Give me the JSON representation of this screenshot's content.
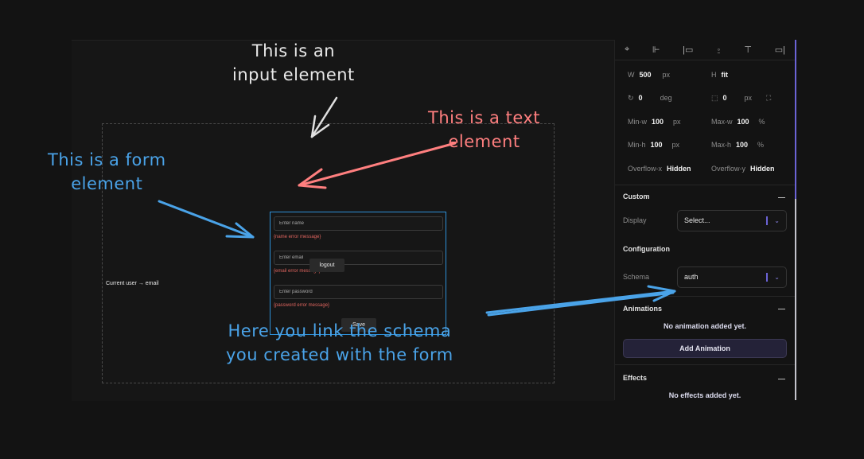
{
  "canvas": {
    "form": {
      "fields": [
        {
          "placeholder": "Enter name",
          "error": "{name error message}"
        },
        {
          "placeholder": "Enter email",
          "error": "{email error message}"
        },
        {
          "placeholder": "Enter password",
          "error": "{password error message}"
        }
      ],
      "save_label": "Save"
    },
    "logout_label": "logout",
    "current_user_text": "Current user → email"
  },
  "annotations": {
    "input_note": "This is an\ninput element",
    "text_note": "This is a text\nelement",
    "form_note": "This is a form\nelement",
    "schema_note": "Here you link the schema\nyou created with the form",
    "colors": {
      "input": "#e8e8e8",
      "text": "#ff7f7f",
      "form": "#4aa3e8"
    }
  },
  "panel": {
    "align_icons": [
      "align-center-horizontal-icon",
      "align-center-vertical-icon",
      "align-left-icon",
      "align-bottom-icon",
      "align-top-icon",
      "align-right-icon"
    ],
    "props": {
      "w": {
        "label": "W",
        "value": "500",
        "unit": "px"
      },
      "h": {
        "label": "H",
        "value": "fit"
      },
      "rotation": {
        "value": "0",
        "unit": "deg"
      },
      "radius": {
        "value": "0",
        "unit": "px"
      },
      "min_w": {
        "label": "Min-w",
        "value": "100",
        "unit": "px"
      },
      "max_w": {
        "label": "Max-w",
        "value": "100",
        "unit": "%"
      },
      "min_h": {
        "label": "Min-h",
        "value": "100",
        "unit": "px"
      },
      "max_h": {
        "label": "Max-h",
        "value": "100",
        "unit": "%"
      },
      "overflow_x": {
        "label": "Overflow-x",
        "value": "Hidden"
      },
      "overflow_y": {
        "label": "Overflow-y",
        "value": "Hidden"
      }
    },
    "custom": {
      "title": "Custom",
      "display_label": "Display",
      "display_value": "Select..."
    },
    "configuration": {
      "title": "Configuration",
      "schema_label": "Schema",
      "schema_value": "auth"
    },
    "animations": {
      "title": "Animations",
      "empty": "No animation added yet.",
      "add_label": "Add Animation"
    },
    "effects": {
      "title": "Effects",
      "empty": "No effects added yet."
    },
    "accent_color": "#6b63d6"
  }
}
